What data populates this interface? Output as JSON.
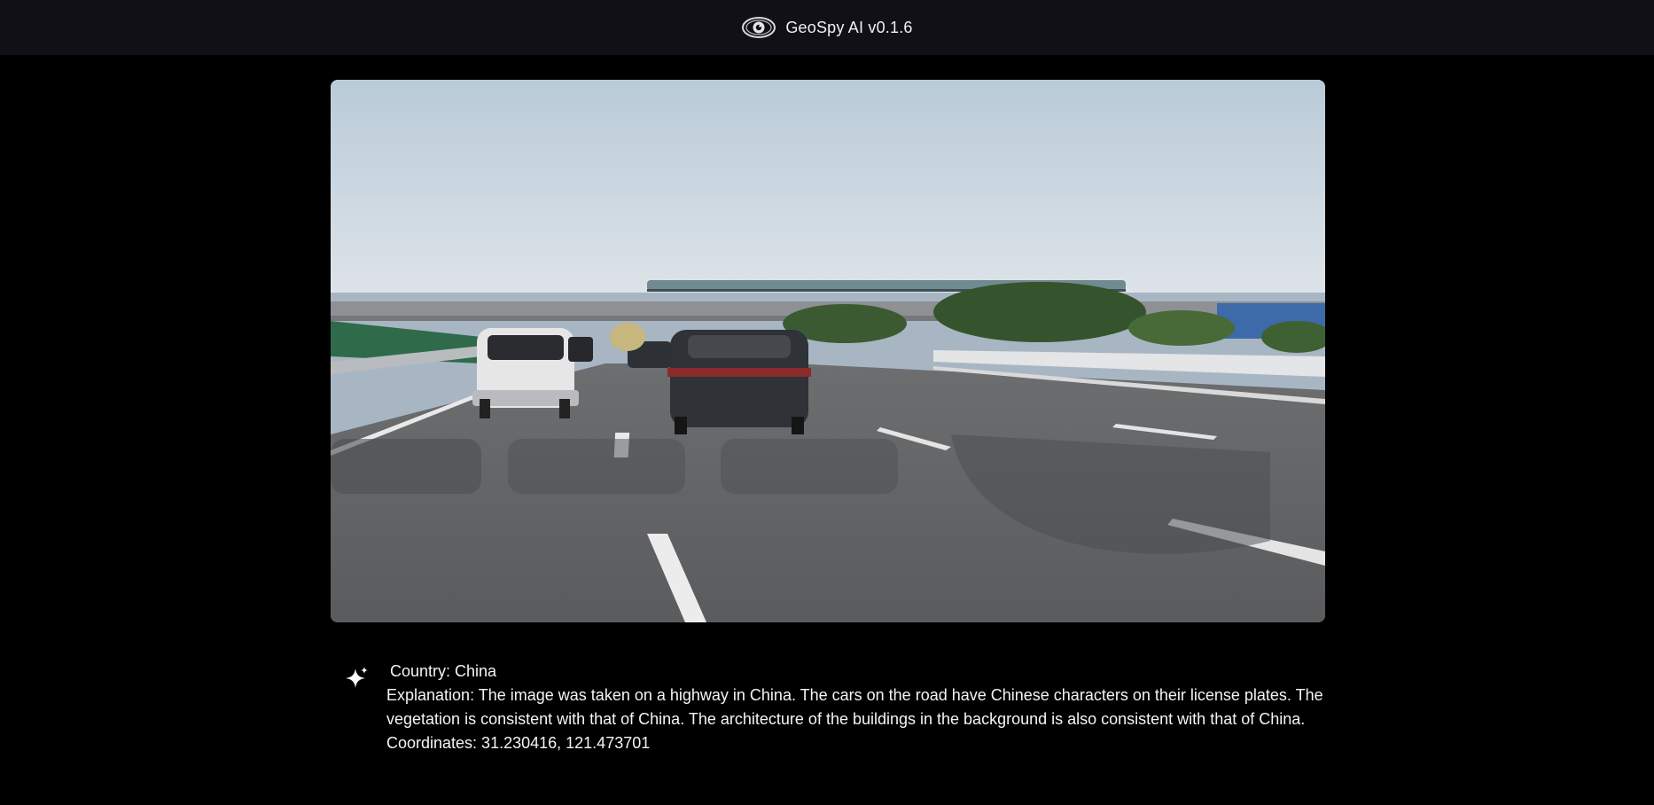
{
  "header": {
    "app_title": "GeoSpy AI v0.1.6",
    "logo_icon": "eye-icon"
  },
  "main": {
    "photo_description_icon": "highway-photo",
    "result": {
      "icon": "sparkle-icon",
      "country": "Country: China",
      "explanation": "Explanation: The image was taken on a highway in China. The cars on the road have Chinese characters on their license plates. The vegetation is consistent with that of China. The architecture of the buildings in the background is also consistent with that of China.",
      "coordinates": "Coordinates: 31.230416, 121.473701"
    }
  },
  "colors": {
    "background": "#000000",
    "header_background": "#111016",
    "text": "#f4f4f4"
  }
}
